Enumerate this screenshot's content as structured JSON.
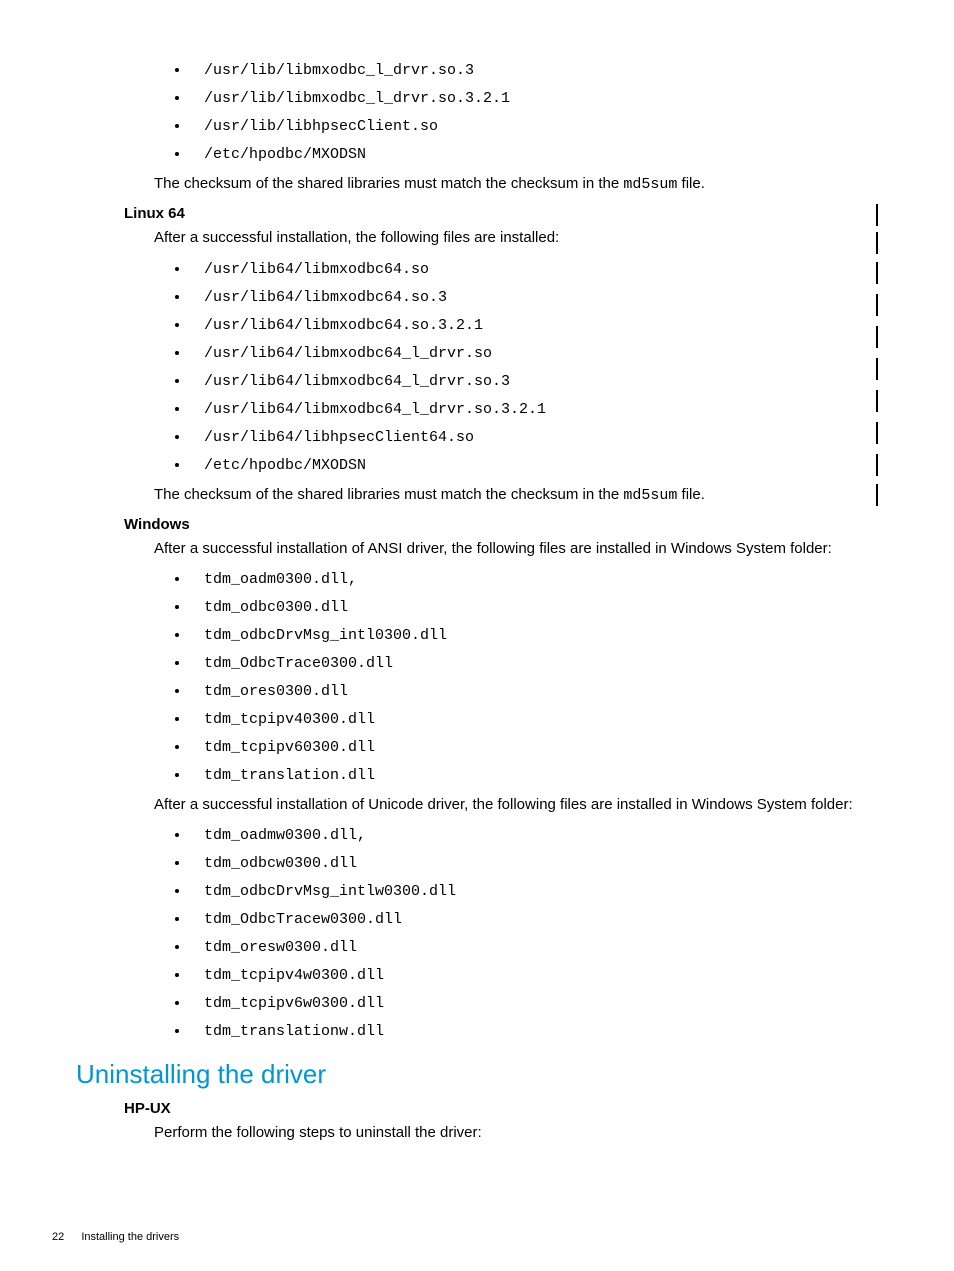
{
  "top_list": [
    "/usr/lib/libmxodbc_l_drvr.so.3",
    "/usr/lib/libmxodbc_l_drvr.so.3.2.1",
    "/usr/lib/libhpsecClient.so",
    "/etc/hpodbc/MXODSN"
  ],
  "checksum_a": "The checksum of the shared libraries must match the checksum in the ",
  "checksum_code": "md5sum",
  "checksum_b": " file.",
  "linux64_head": "Linux 64",
  "linux64_intro": "After a successful installation, the following files are installed:",
  "linux64_list": [
    "/usr/lib64/libmxodbc64.so",
    "/usr/lib64/libmxodbc64.so.3",
    "/usr/lib64/libmxodbc64.so.3.2.1",
    "/usr/lib64/libmxodbc64_l_drvr.so",
    "/usr/lib64/libmxodbc64_l_drvr.so.3",
    "/usr/lib64/libmxodbc64_l_drvr.so.3.2.1",
    "/usr/lib64/libhpsecClient64.so",
    "/etc/hpodbc/MXODSN"
  ],
  "windows_head": "Windows",
  "windows_intro": "After a successful installation of ANSI driver, the following files are installed in Windows System folder:",
  "windows_list1": [
    "tdm_oadm0300.dll,",
    "tdm_odbc0300.dll",
    "tdm_odbcDrvMsg_intl0300.dll",
    "tdm_OdbcTrace0300.dll",
    "tdm_ores0300.dll",
    "tdm_tcpipv40300.dll",
    "tdm_tcpipv60300.dll",
    "tdm_translation.dll"
  ],
  "windows_intro2": "After a successful installation of Unicode driver, the following files are installed in Windows System folder:",
  "windows_list2": [
    "tdm_oadmw0300.dll,",
    "tdm_odbcw0300.dll",
    "tdm_odbcDrvMsg_intlw0300.dll",
    "tdm_OdbcTracew0300.dll",
    "tdm_oresw0300.dll",
    "tdm_tcpipv4w0300.dll",
    "tdm_tcpipv6w0300.dll",
    "tdm_translationw.dll"
  ],
  "uninstall_title": "Uninstalling the driver",
  "hpux_head": "HP-UX",
  "hpux_intro": "Perform the following steps to uninstall the driver:",
  "footer_page": "22",
  "footer_text": "Installing the drivers"
}
